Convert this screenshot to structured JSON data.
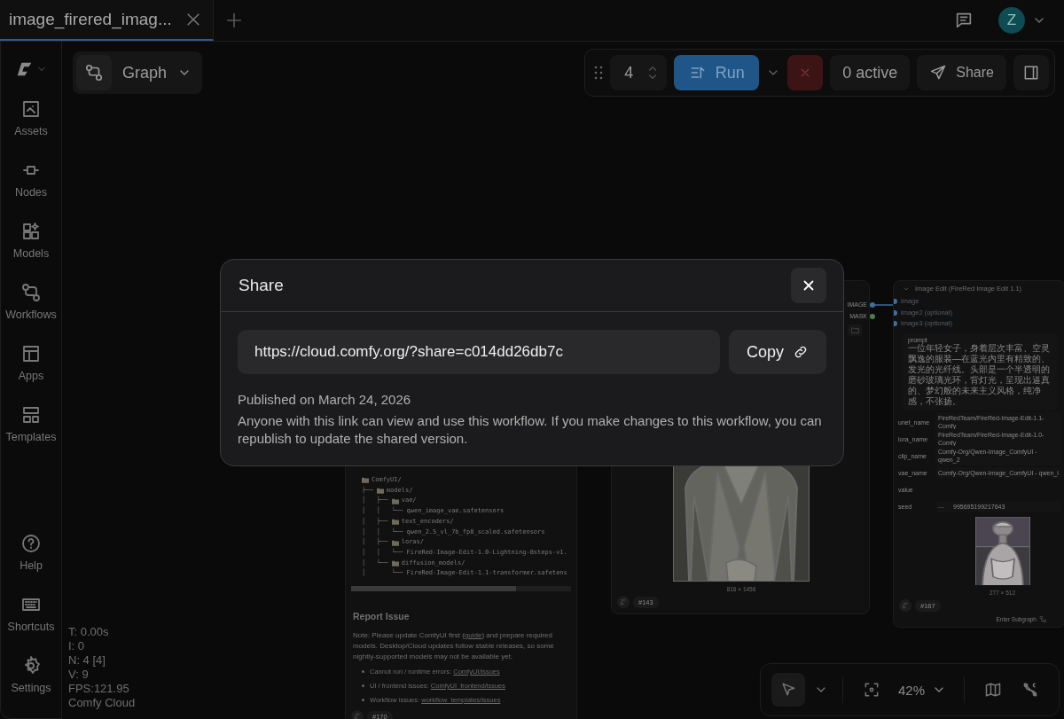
{
  "tabs": [
    {
      "label": "image_firered_imag...",
      "selected": true
    }
  ],
  "topbar": {
    "avatar": "Z"
  },
  "sidebar": {
    "items": [
      {
        "label": "Assets"
      },
      {
        "label": "Nodes"
      },
      {
        "label": "Models"
      },
      {
        "label": "Workflows"
      },
      {
        "label": "Apps"
      },
      {
        "label": "Templates"
      }
    ],
    "bottom_items": [
      {
        "label": "Help"
      },
      {
        "label": "Shortcuts"
      },
      {
        "label": "Settings"
      }
    ]
  },
  "graph_button": {
    "label": "Graph"
  },
  "run_toolbar": {
    "batch_count": "4",
    "run_label": "Run",
    "active": "0 active",
    "share_label": "Share"
  },
  "stats": [
    "T: 0.00s",
    "I: 0",
    "N: 4 [4]",
    "V: 9",
    "FPS:121.95",
    "Comfy Cloud"
  ],
  "note_node": {
    "tree": [
      {
        "folder": true,
        "name": "ComfyUI/"
      },
      {
        "prefix": "├── ",
        "folder": true,
        "name": "models/"
      },
      {
        "prefix": "│   ├── ",
        "folder": true,
        "name": "vae/"
      },
      {
        "prefix": "│   │   └── ",
        "folder": false,
        "name": "qwen_image_vae.safetensors"
      },
      {
        "prefix": "│   ├── ",
        "folder": true,
        "name": "text_encoders/"
      },
      {
        "prefix": "│   │   └── ",
        "folder": false,
        "name": "qwen_2.5_vl_7b_fp8_scaled.safetensors"
      },
      {
        "prefix": "│   ├── ",
        "folder": true,
        "name": "loras/"
      },
      {
        "prefix": "│   │   └── ",
        "folder": false,
        "name": "FireRed-Image-Edit-1.0-Lightning-8steps-v1."
      },
      {
        "prefix": "│   └── ",
        "folder": true,
        "name": "diffusion_models/"
      },
      {
        "prefix": "│       └── ",
        "folder": false,
        "name": "FireRed-Image-Edit-1.1-transformer.safetens"
      }
    ],
    "heading": "Report Issue",
    "note": {
      "before": "Note: Please update ComfyUI first (",
      "link": "guide",
      "after": ") and prepare required models. Desktop/Cloud updates follow stable releases, so some nightly-supported models may not be available yet."
    },
    "bullets": [
      {
        "label": "Cannot run / runtime errors:",
        "link": "ComfyUI/issues"
      },
      {
        "label": "UI / frontend issues:",
        "link": "ComfyUI_frontend/issues"
      },
      {
        "label": "Workflow issues:",
        "link": "workflow_templates/issues"
      }
    ],
    "id": "#170"
  },
  "load_image_node": {
    "outputs": [
      {
        "label": "IMAGE",
        "color": "#3d6e9c"
      },
      {
        "label": "MASK",
        "color": "#4e7d45"
      }
    ],
    "size": "816 × 1456",
    "id": "#143"
  },
  "edit_node": {
    "title": "Image Edit (FireRed Image Edit 1.1)",
    "inputs": [
      {
        "label": "image",
        "color": "#3d6e9c"
      },
      {
        "label": "image2 (optional)",
        "color": "#3d6e9c"
      },
      {
        "label": "image3 (optional)",
        "color": "#3d6e9c"
      }
    ],
    "prompt_label": "prompt",
    "prompt": "一位年轻女子，身着层次丰富、空灵飘逸的服装—在蓝光内里有精致的、发光的光纤线。头部是一个半透明的磨砂玻璃光环，背灯光，呈现出逼真的、梦幻般的未来主义风格，纯净感，不张扬。",
    "widgets": [
      {
        "kind": "combo",
        "label": "unet_name",
        "value": "FireRedTeam/FireRed-Image-Edit-1.1-Comfy"
      },
      {
        "kind": "combo",
        "label": "lora_name",
        "value": "FireRedTeam/FireRed-Image-Edit-1.0-Comfy"
      },
      {
        "kind": "combo",
        "label": "clip_name",
        "value": "Comfy-Org/Qwen-Image_ComfyUI - qwen_2"
      },
      {
        "kind": "combo",
        "label": "vae_name",
        "value": "Comfy-Org/Qwen-Image_ComfyUI - qwen_i"
      },
      {
        "kind": "label",
        "label": "value"
      },
      {
        "kind": "number",
        "label": "seed",
        "value": "995695199217643",
        "minus": "—"
      }
    ],
    "size": "277 × 512",
    "id": "#167",
    "subgraph_label": "Enter Subgraph"
  },
  "canvas_toolbar": {
    "tools": [
      {
        "kind": "pointer",
        "selected": true
      }
    ],
    "zoom": "42%"
  },
  "share_dialog": {
    "title": "Share",
    "url": "https://cloud.comfy.org/?share=c014dd26db7c",
    "copy_label": "Copy",
    "published": "Published on March 24, 2026",
    "description": "Anyone with this link can view and use this workflow. If you make changes to this workflow, you can republish to update the shared version."
  }
}
